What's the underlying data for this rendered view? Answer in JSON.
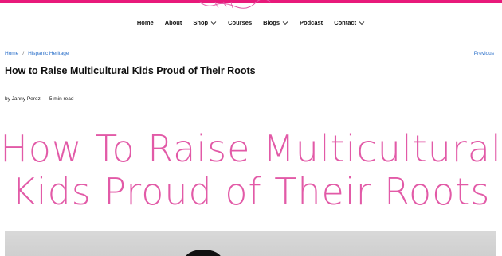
{
  "brand": {
    "accent": "#e8197a",
    "hero_color": "#e25aa7",
    "link_color": "#2a6fc9"
  },
  "nav": {
    "items": [
      {
        "label": "Home",
        "has_dropdown": false
      },
      {
        "label": "About",
        "has_dropdown": false
      },
      {
        "label": "Shop",
        "has_dropdown": true
      },
      {
        "label": "Courses",
        "has_dropdown": false
      },
      {
        "label": "Blogs",
        "has_dropdown": true
      },
      {
        "label": "Podcast",
        "has_dropdown": false
      },
      {
        "label": "Contact",
        "has_dropdown": true
      }
    ]
  },
  "breadcrumb": {
    "home": "Home",
    "separator": "/",
    "category": "Hispanic Heritage"
  },
  "pagination": {
    "previous": "Previous"
  },
  "post": {
    "title": "How to Raise Multicultural Kids Proud of Their Roots",
    "author": "by Janny Perez",
    "read_time": "5 min read"
  },
  "hero": {
    "line1": "How To Raise Multicultural",
    "line2": "Kids Proud of Their Roots"
  }
}
